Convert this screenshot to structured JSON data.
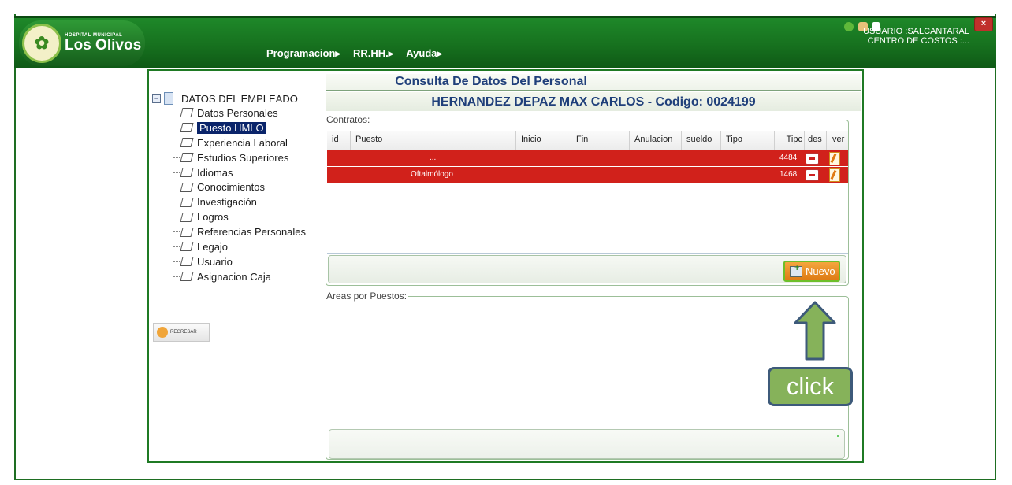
{
  "app": {
    "logo_small": "HOSPITAL MUNICIPAL",
    "logo_name": "Los Olivos",
    "user_label": "USUARIO :SALCANTARAL",
    "cost_center": "CENTRO DE COSTOS :...",
    "close_label": "×"
  },
  "menu": [
    {
      "label": "Programacion▸"
    },
    {
      "label": "RR.HH.▸"
    },
    {
      "label": "Ayuda▸"
    }
  ],
  "page": {
    "title": "Consulta De Datos Del Personal",
    "employee": "HERNANDEZ DEPAZ MAX CARLOS - Codigo: 0024199"
  },
  "tree": {
    "root_label": "DATOS DEL EMPLEADO",
    "items": [
      {
        "label": "Datos Personales"
      },
      {
        "label": "Puesto HMLO"
      },
      {
        "label": "Experiencia Laboral"
      },
      {
        "label": "Estudios Superiores"
      },
      {
        "label": "Idiomas"
      },
      {
        "label": "Conocimientos"
      },
      {
        "label": "Investigación"
      },
      {
        "label": "Logros"
      },
      {
        "label": "Referencias Personales"
      },
      {
        "label": "Legajo"
      },
      {
        "label": "Usuario"
      },
      {
        "label": "Asignacion Caja"
      }
    ],
    "selected": "Puesto HMLO"
  },
  "back_button": {
    "label": "REGRESAR"
  },
  "contracts": {
    "legend": "Contratos:",
    "columns": [
      "id",
      "Puesto",
      "Inicio",
      "Fin",
      "Anulacion",
      "sueldo",
      "Tipo",
      "Tipc",
      "des",
      "ver"
    ],
    "rows": [
      {
        "puesto": "...",
        "tipc": "4484"
      },
      {
        "puesto": "Oftalmólogo",
        "tipc": "1468"
      }
    ],
    "row_color": "#d1211b",
    "new_button": "Nuevo"
  },
  "areas": {
    "legend": "Areas por Puestos:"
  },
  "annotation": {
    "label": "click",
    "box_color": "#86b25a"
  }
}
